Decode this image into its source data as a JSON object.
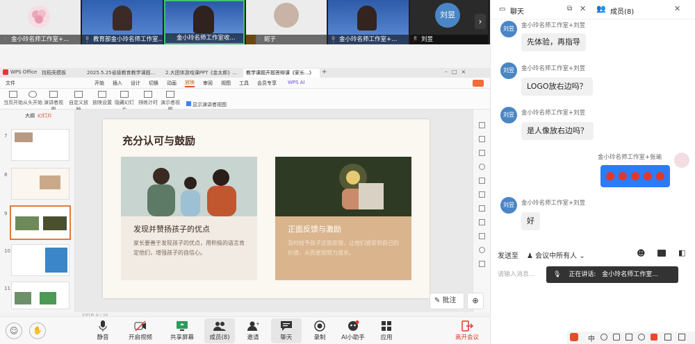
{
  "video_strip": {
    "tiles": [
      {
        "name": "金小玲名师工作室+..."
      },
      {
        "name": "教育部金小玲名师工作室..."
      },
      {
        "name": "金小玲名师工作室收..."
      },
      {
        "name": "妮子"
      },
      {
        "name": "金小玲名师工作室+..."
      },
      {
        "name": "刘昱",
        "avatar_text": "刘昱"
      }
    ]
  },
  "collapse_icon": "chevron-up-icon",
  "wps": {
    "tabs": [
      "WPS Office",
      "找稻壳模板",
      "2025.5.25省级教育教学课题...",
      "2.大团体游戏课PPT《金太郎》...",
      "教学课题开题答辩课《家长...》"
    ],
    "menu": [
      "文件",
      "开始",
      "插入",
      "设计",
      "切换",
      "动画",
      "放映",
      "审阅",
      "视图",
      "工具",
      "会员专享",
      "WPS AI"
    ],
    "ribbon": [
      "当页开始",
      "从头开始",
      "演讲者视图",
      "自定义放映",
      "放映设置",
      "隐藏幻灯片",
      "排练计时",
      "演示者视图",
      "显示演讲者视图"
    ],
    "panel_tabs": [
      "大纲",
      "幻灯片"
    ],
    "slide_numbers": [
      "7",
      "8",
      "9",
      "10",
      "11"
    ],
    "status_left": "幻灯片 9 / 20"
  },
  "slide": {
    "title": "充分认可与鼓励",
    "card1_title": "发现并赞扬孩子的优点",
    "card1_body": "家长要善于发现孩子的优点，用积极的语言肯定他们，增强孩子的自信心。",
    "card2_title": "正面反馈与激励",
    "card2_body": "及时给予孩子正面反馈，让他们感受到自己的价值，从而更加努力成长。"
  },
  "annotate": {
    "label": "批注"
  },
  "toolbar": {
    "mute": "静音",
    "video": "开启视频",
    "share": "共享屏幕",
    "members": "成员(8)",
    "invite": "邀请",
    "chat": "聊天",
    "record": "录制",
    "ai": "AI小助手",
    "apps": "应用",
    "leave": "离开会议"
  },
  "chat": {
    "title": "聊天",
    "members_tab": "成员(8)",
    "messages": [
      {
        "sender": "金小玲名师工作室+刘昱",
        "avatar": "刘昱",
        "text": "先体验，再指导"
      },
      {
        "sender": "金小玲名师工作室+刘昱",
        "avatar": "刘昱",
        "text": "LOGO放右边吗？"
      },
      {
        "sender": "金小玲名师工作室+刘昱",
        "avatar": "刘昱",
        "text": "是人像放右边吗？"
      },
      {
        "sender": "金小玲名师工作室+张瑜",
        "avatar": "",
        "text": ""
      },
      {
        "sender": "金小玲名师工作室+刘昱",
        "avatar": "刘昱",
        "text": "好"
      }
    ],
    "send_to_label": "发送至",
    "send_to_value": "会议中所有人",
    "input_placeholder": "请输入消息...",
    "speaking_label": "正在讲话:",
    "speaking_name": "金小玲名师工作室...",
    "colors": {
      "accent": "#2b7cf6",
      "avatar": "#4a86c5",
      "leave": "#e3372b"
    }
  }
}
